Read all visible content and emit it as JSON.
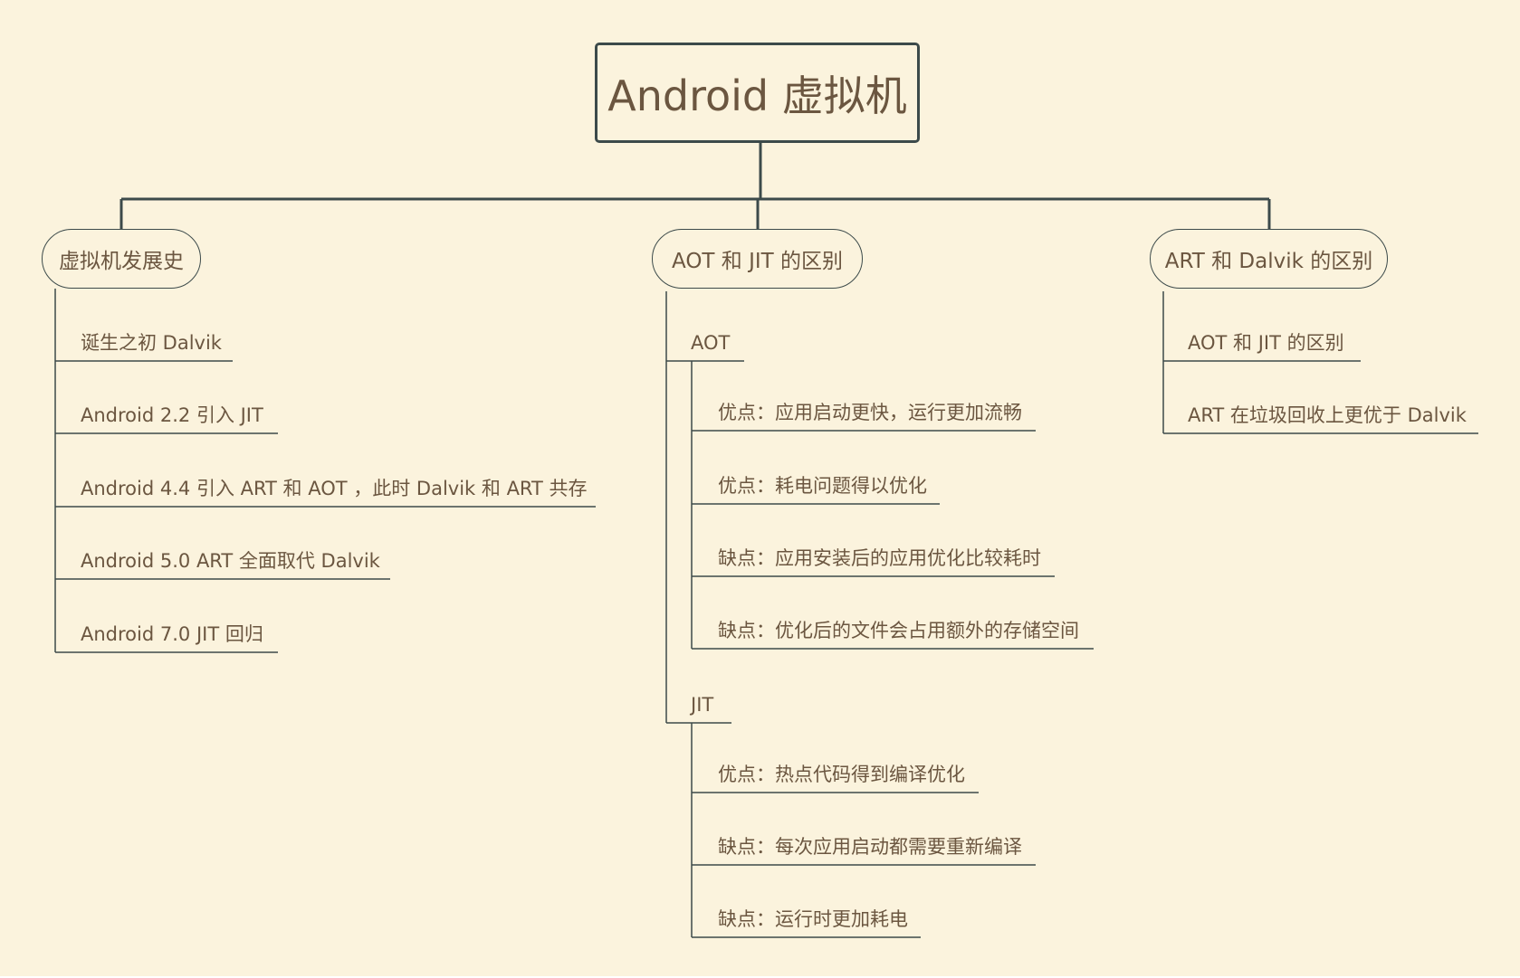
{
  "root": {
    "label": "Android 虚拟机"
  },
  "branches": [
    {
      "label": "虚拟机发展史",
      "items": [
        "诞生之初 Dalvik",
        "Android 2.2 引入 JIT",
        "Android 4.4 引入 ART 和 AOT ，此时 Dalvik 和 ART 共存",
        "Android 5.0 ART 全面取代 Dalvik",
        "Android 7.0 JIT 回归"
      ]
    },
    {
      "label": "AOT 和 JIT 的区别",
      "groups": [
        {
          "label": "AOT",
          "items": [
            "优点：应用启动更快，运行更加流畅",
            "优点：耗电问题得以优化",
            "缺点：应用安装后的应用优化比较耗时",
            "缺点：优化后的文件会占用额外的存储空间"
          ]
        },
        {
          "label": "JIT",
          "items": [
            "优点：热点代码得到编译优化",
            "缺点：每次应用启动都需要重新编译",
            "缺点：运行时更加耗电"
          ]
        }
      ]
    },
    {
      "label": "ART 和 Dalvik 的区别",
      "items": [
        "AOT 和 JIT 的区别",
        "ART 在垃圾回收上更优于 Dalvik"
      ]
    }
  ]
}
